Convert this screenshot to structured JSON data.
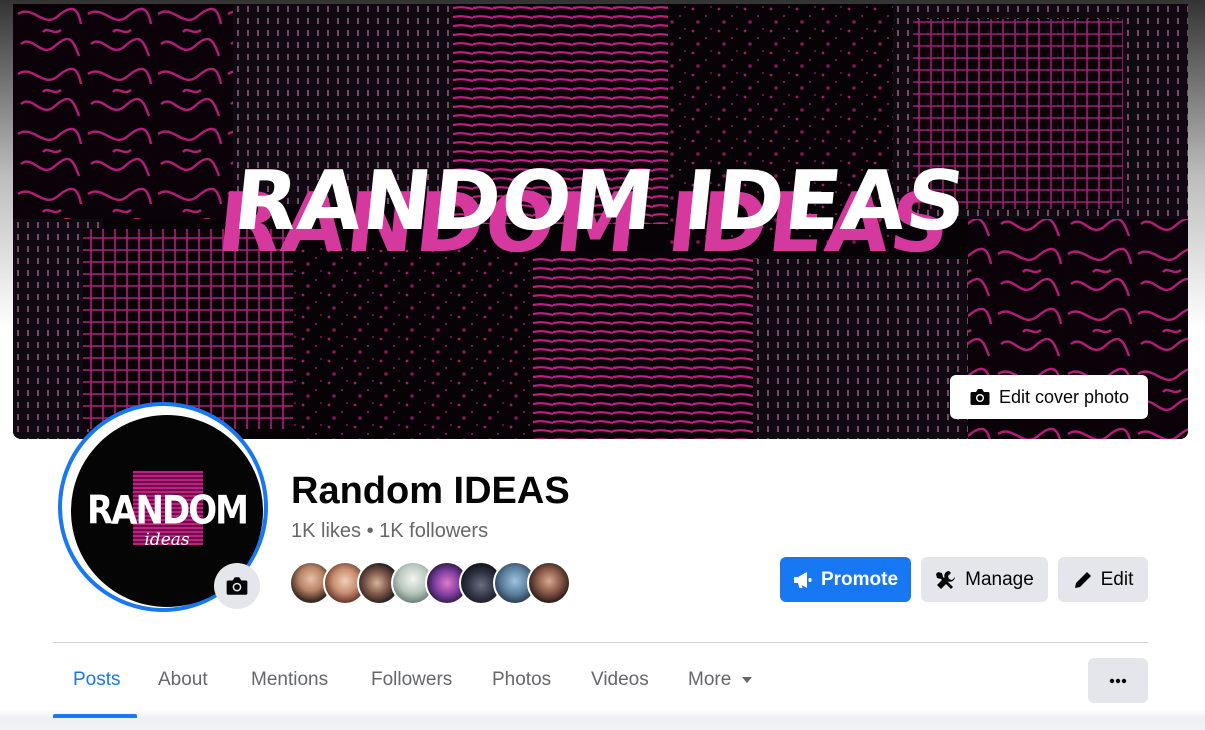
{
  "cover": {
    "title_text": "RANDOM IDEAS",
    "edit_label": "Edit cover photo"
  },
  "avatar": {
    "logo_main": "RANDOM",
    "logo_sub": "ideas"
  },
  "page": {
    "name": "Random IDEAS",
    "stats": "1K likes • 1K followers"
  },
  "actions": {
    "promote": "Promote",
    "manage": "Manage",
    "edit": "Edit"
  },
  "tabs": [
    {
      "label": "Posts"
    },
    {
      "label": "About"
    },
    {
      "label": "Mentions"
    },
    {
      "label": "Followers"
    },
    {
      "label": "Photos"
    },
    {
      "label": "Videos"
    },
    {
      "label": "More"
    }
  ],
  "colors": {
    "accent": "#1877f2",
    "cover_pink": "#c21f83",
    "secondary_button": "#e4e6eb",
    "muted_text": "#65676b"
  }
}
